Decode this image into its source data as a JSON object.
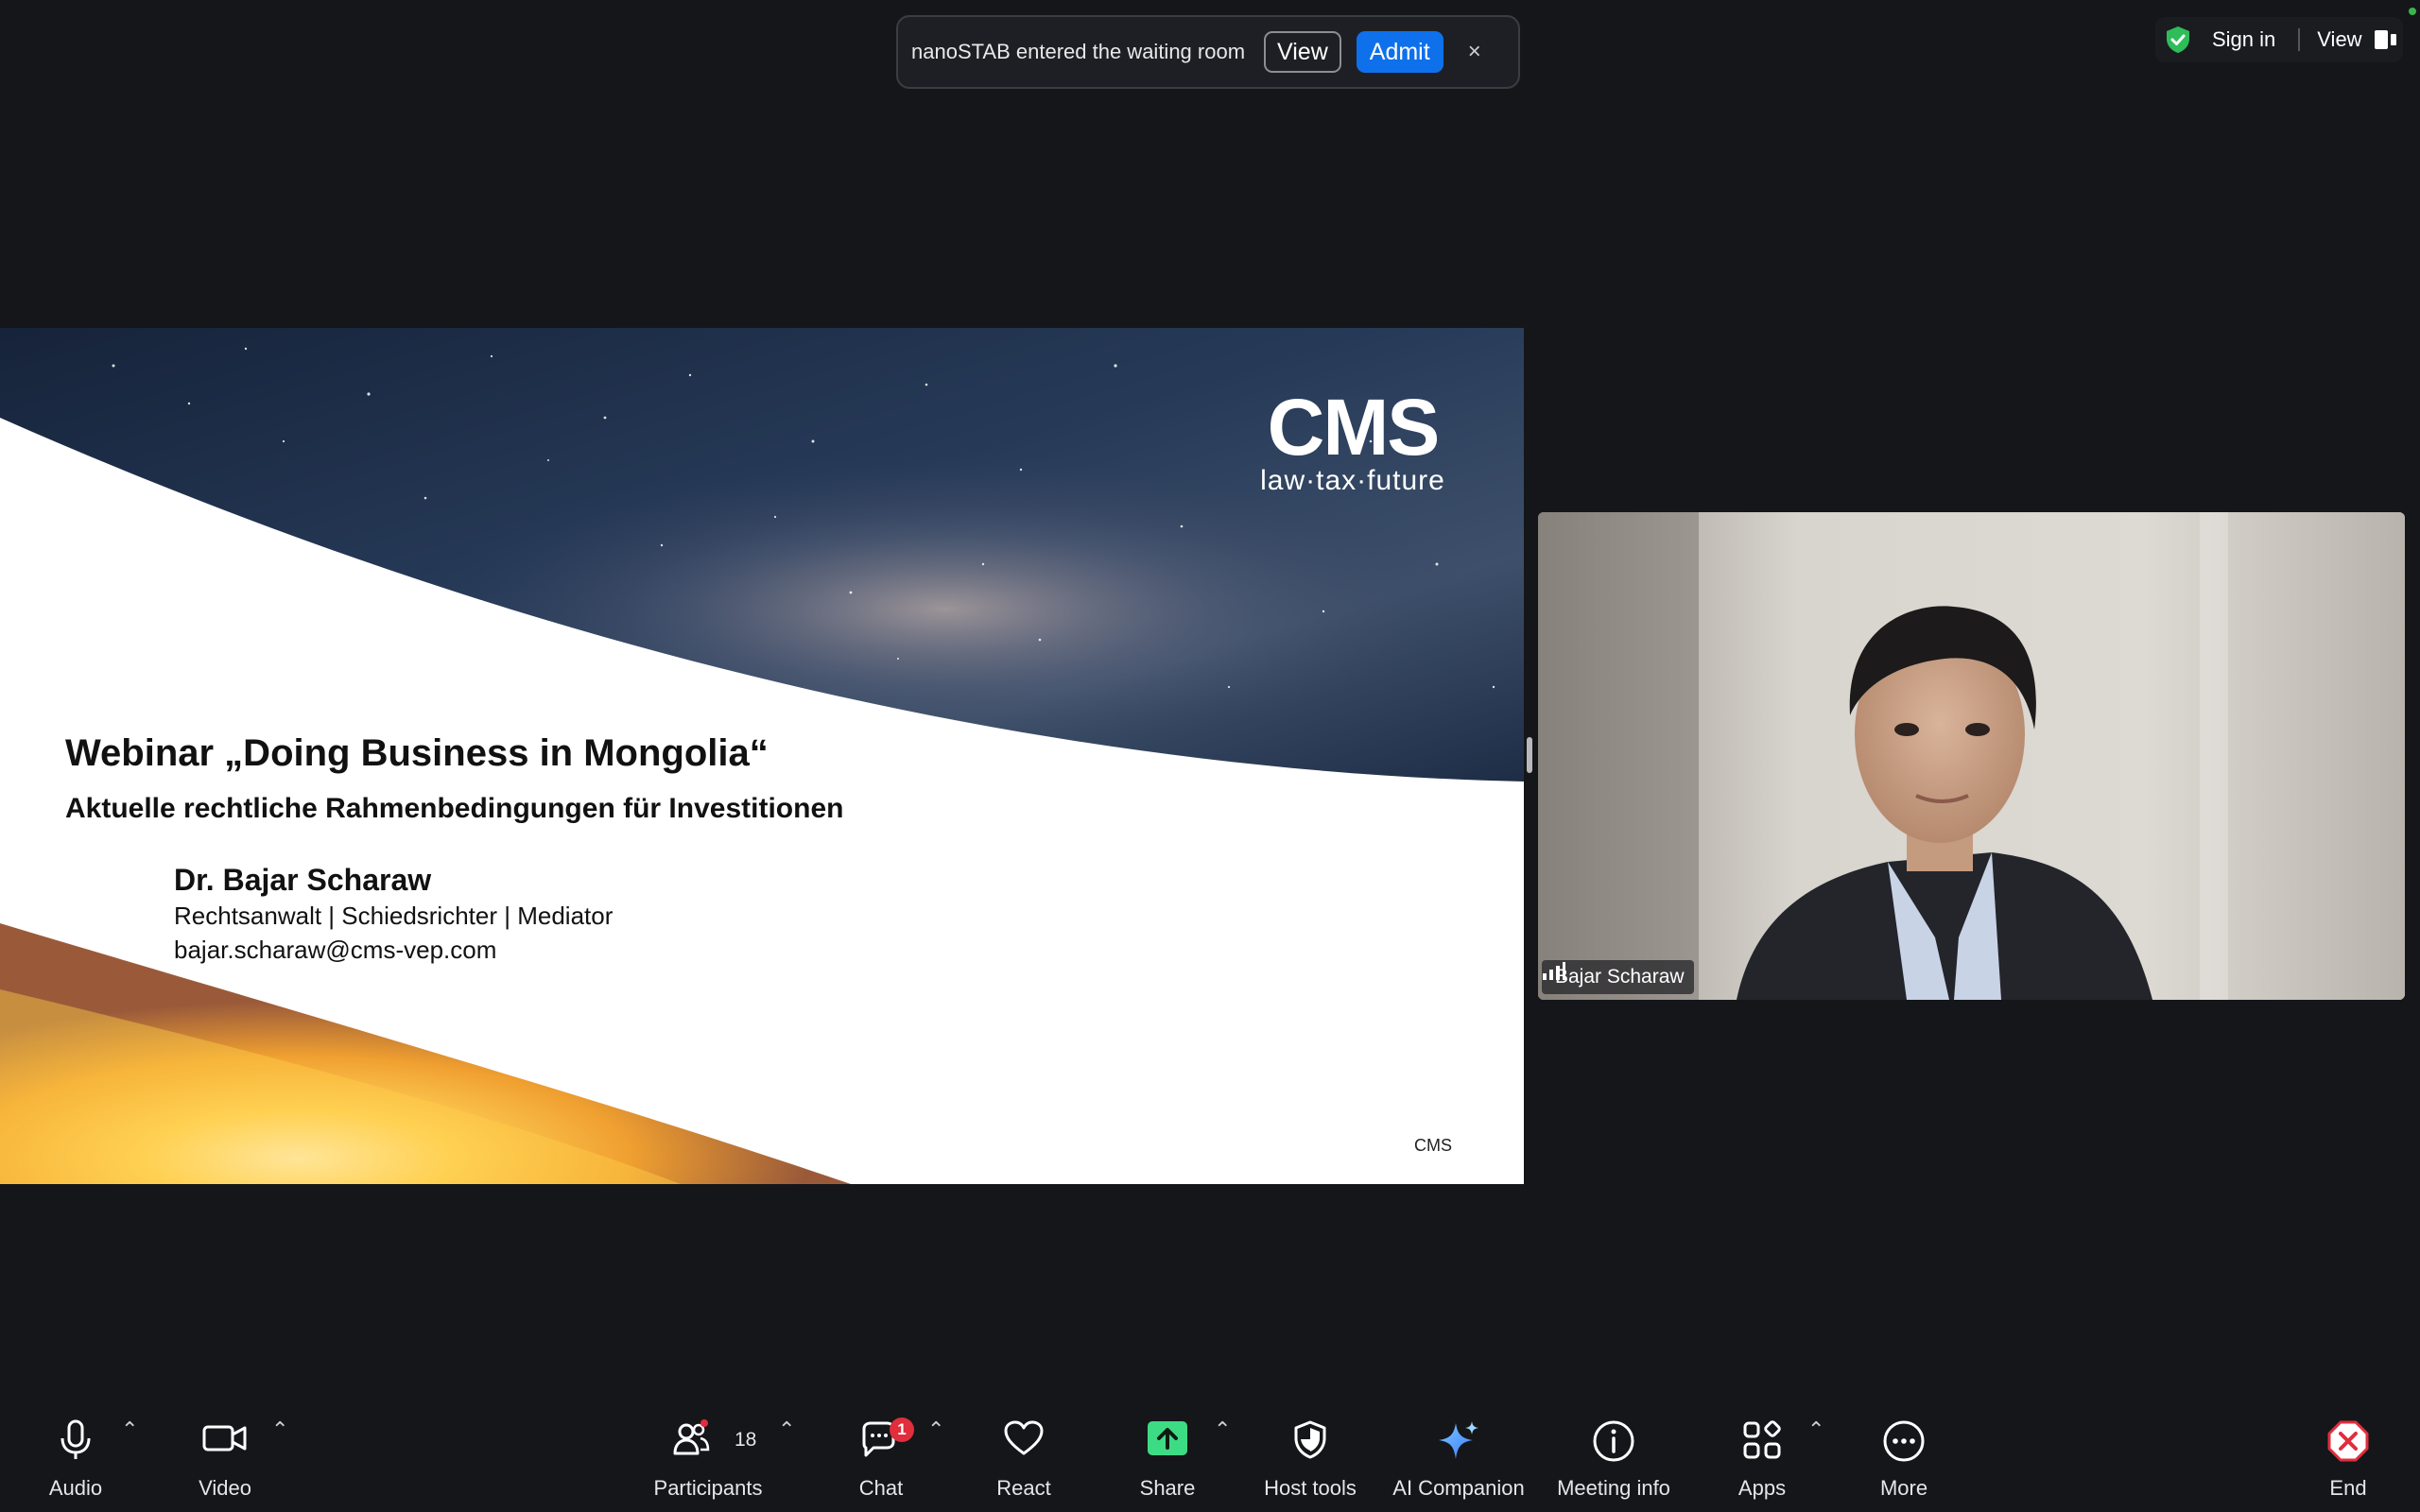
{
  "notification": {
    "message": "nanoSTAB entered the waiting room",
    "view_label": "View",
    "admit_label": "Admit",
    "close_glyph": "×"
  },
  "topbar": {
    "sign_in": "Sign in",
    "view": "View",
    "security_icon": "green-shield-check-icon"
  },
  "slide": {
    "logo": "CMS",
    "logo_tagline": "law·tax·future",
    "title": "Webinar „Doing Business in Mongolia“",
    "subtitle": "Aktuelle rechtliche Rahmenbedingungen für Investitionen",
    "presenter": "Dr. Bajar Scharaw",
    "roles": "Rechtsanwalt | Schiedsrichter | Mediator",
    "email": "bajar.scharaw@cms-vep.com",
    "footer": "CMS"
  },
  "video": {
    "participant_name": "Bajar Scharaw"
  },
  "toolbar": {
    "audio": "Audio",
    "video": "Video",
    "participants": "Participants",
    "participants_count": "18",
    "chat": "Chat",
    "chat_badge": "1",
    "react": "React",
    "share": "Share",
    "host_tools": "Host tools",
    "ai_companion": "AI Companion",
    "meeting_info": "Meeting info",
    "apps": "Apps",
    "more": "More",
    "end": "End"
  },
  "colors": {
    "background": "#15161a",
    "admit": "#0e71eb",
    "share": "#3ddc84",
    "end": "#e02e3c",
    "badge": "#e02e3c"
  }
}
